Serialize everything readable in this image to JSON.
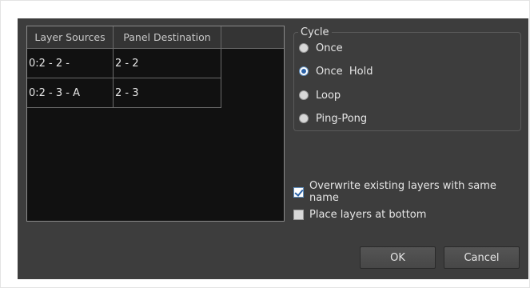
{
  "table": {
    "headers": [
      "Layer Sources",
      "Panel Destination"
    ],
    "rows": [
      {
        "source": "0:2 - 2 -",
        "destination": "2 - 2"
      },
      {
        "source": "0:2 - 3 - A",
        "destination": "2 - 3"
      }
    ]
  },
  "cycle": {
    "title": "Cycle",
    "options": [
      "Once",
      "Once  Hold",
      "Loop",
      "Ping-Pong"
    ],
    "selected": "Once  Hold"
  },
  "options": {
    "overwrite_label": "Overwrite existing layers with same name",
    "overwrite_checked": true,
    "bottom_label": "Place layers at bottom",
    "bottom_checked": false
  },
  "buttons": {
    "ok_label": "OK",
    "cancel_label": "Cancel"
  },
  "colors": {
    "dialog_bg": "#3d3d3d",
    "table_bg": "#111111",
    "accent": "#2a62a8"
  }
}
